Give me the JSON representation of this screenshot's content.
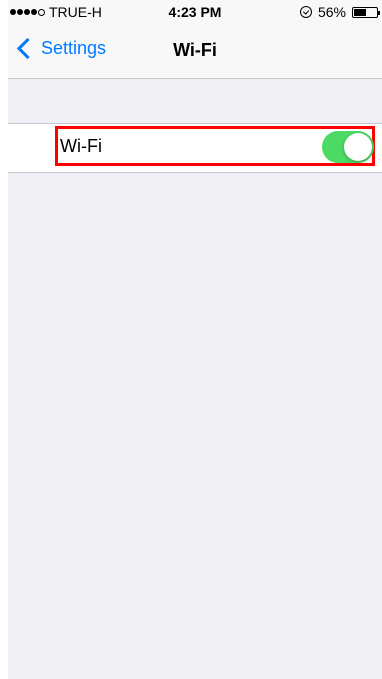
{
  "status_bar": {
    "carrier": "TRUE-H",
    "signal_bars_filled": 4,
    "signal_bars_total": 5,
    "time": "4:23 PM",
    "battery_percent": "56%",
    "battery_level": 0.56
  },
  "nav": {
    "back_label": "Settings",
    "title": "Wi-Fi"
  },
  "wifi_row": {
    "label": "Wi-Fi",
    "enabled": true,
    "toggle_color": "#4cd964"
  },
  "colors": {
    "accent": "#007aff",
    "highlight": "#ff0000",
    "background": "#efeff4"
  }
}
